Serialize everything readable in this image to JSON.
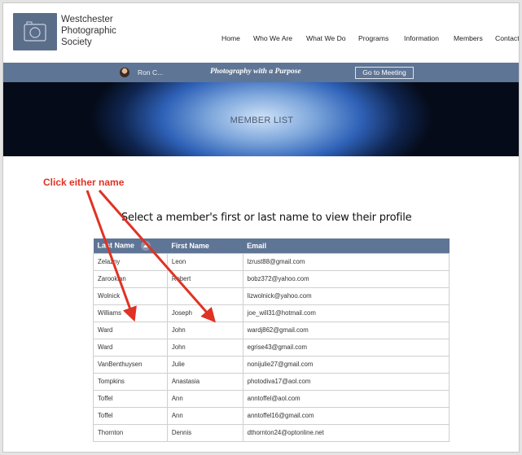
{
  "header": {
    "logo_lines": [
      "Westchester",
      "Photographic",
      "Society"
    ],
    "nav": [
      "Home",
      "Who We Are",
      "What We Do",
      "Programs",
      "Information",
      "Members",
      "Contact"
    ]
  },
  "bar": {
    "user": "Ron C...",
    "tagline": "Photography with a Purpose",
    "meeting_button": "Go to Meeting"
  },
  "banner": {
    "title": "MEMBER LIST"
  },
  "annotation": {
    "text": "Click  either name"
  },
  "instruction": "Select a member's first or last name to view their profile",
  "table": {
    "headers": [
      "Last Name",
      "First Name",
      "Email"
    ],
    "rows": [
      [
        "Zelazny",
        "Leon",
        "lzrust88@gmail.com"
      ],
      [
        "Zarookian",
        "Robert",
        "bobz372@yahoo.com"
      ],
      [
        "Wolnick",
        "",
        "lizwolnick@yahoo.com"
      ],
      [
        "Williams",
        "Joseph",
        "joe_will31@hotmail.com"
      ],
      [
        "Ward",
        "John",
        "wardj862@gmail.com"
      ],
      [
        "Ward",
        "John",
        "egrise43@gmail.com"
      ],
      [
        "VanBenthuysen",
        "Julie",
        "nonijulie27@gmail.com"
      ],
      [
        "Tompkins",
        "Anastasia",
        "photodiva17@aol.com"
      ],
      [
        "Toffel",
        "Ann",
        "anntoffel@aol.com"
      ],
      [
        "Toffel",
        "Ann",
        "anntoffel16@gmail.com"
      ],
      [
        "Thornton",
        "Dennis",
        "dthornton24@optonline.net"
      ]
    ]
  },
  "colors": {
    "nav_bar": "#5f7595",
    "annotation": "#e03224"
  }
}
